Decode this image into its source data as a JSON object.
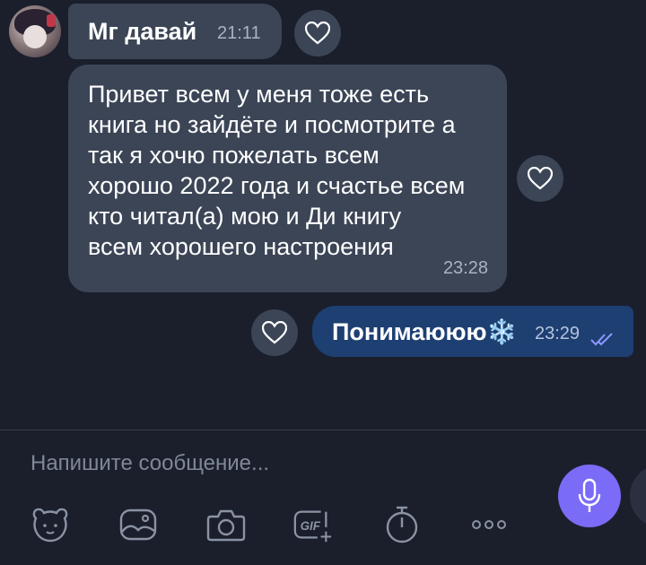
{
  "messages": [
    {
      "direction": "incoming",
      "text": "Мг давай",
      "time": "21:11"
    },
    {
      "direction": "incoming",
      "lines": [
        "Привет всем у меня тоже есть",
        "книга но зайдёте и посмотрите а",
        "так я хочю пожелать всем",
        "хорошо 2022 года и счастье всем",
        "кто читал(а) мою и Ди книгу",
        "всем хорошего настроения"
      ],
      "time": "23:28"
    },
    {
      "direction": "outgoing",
      "text": "Понимаююю❄️",
      "time": "23:29",
      "status_icon": "double-check-icon"
    }
  ],
  "composer": {
    "placeholder": "Напишите сообщение..."
  },
  "toolbar": {
    "items": [
      "sticker-icon",
      "gallery-icon",
      "camera-icon",
      "gif-icon",
      "timer-icon",
      "more-icon"
    ],
    "gif_label": "GIF"
  },
  "colors": {
    "background": "#1b1f2c",
    "incoming_bubble": "#3b4556",
    "outgoing_bubble": "#1e3f72",
    "accent": "#7a6cf6"
  }
}
